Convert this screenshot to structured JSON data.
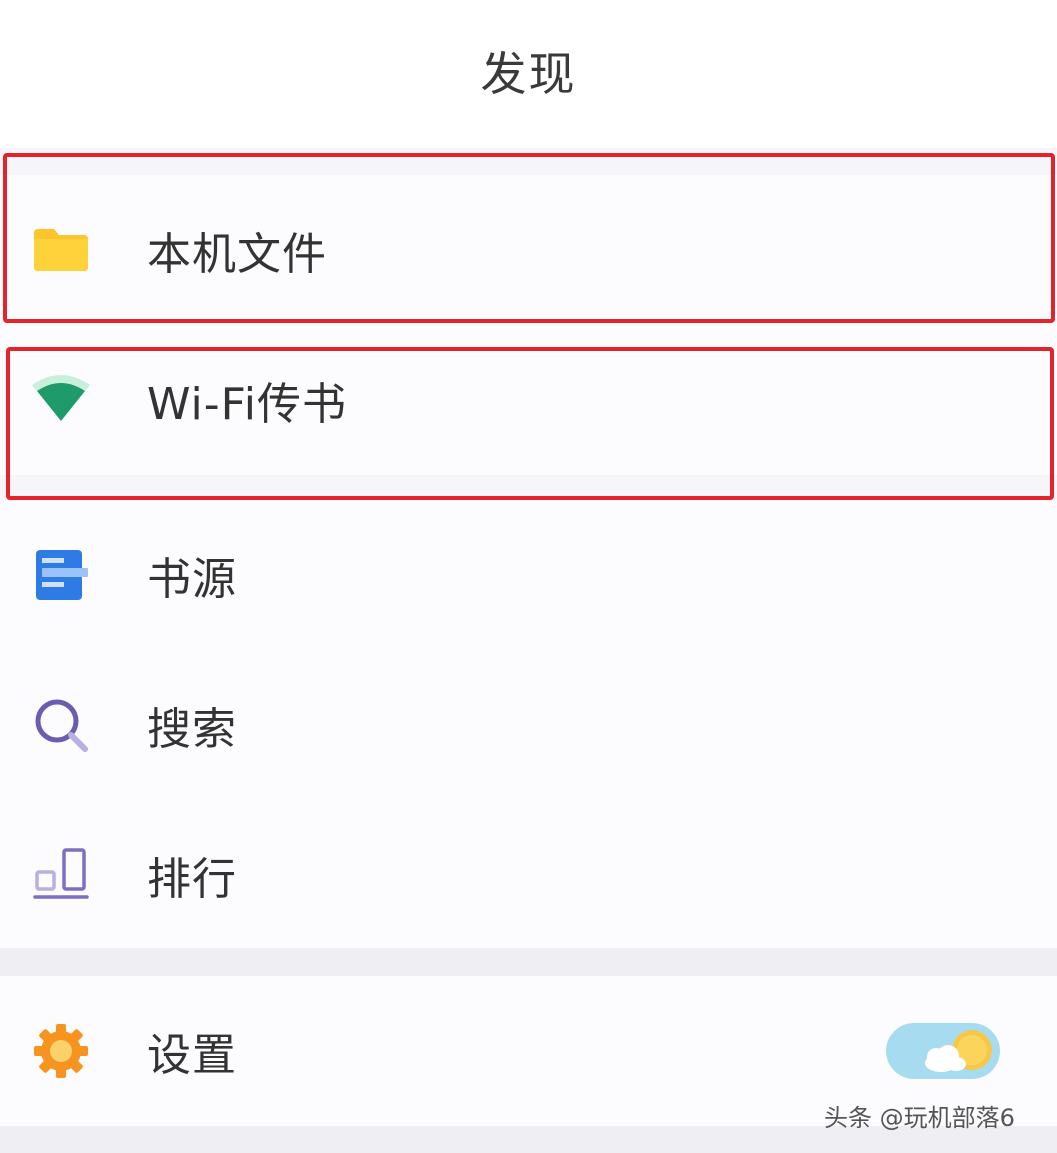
{
  "header": {
    "title": "发现"
  },
  "menu": {
    "items": [
      {
        "id": "local-files",
        "label": "本机文件",
        "icon": "folder-icon",
        "highlighted": true
      },
      {
        "id": "wifi-transfer",
        "label": "Wi-Fi传书",
        "icon": "wifi-icon",
        "highlighted": true
      },
      {
        "id": "book-source",
        "label": "书源",
        "icon": "book-source-icon",
        "highlighted": false
      },
      {
        "id": "search",
        "label": "搜索",
        "icon": "search-icon",
        "highlighted": false
      },
      {
        "id": "ranking",
        "label": "排行",
        "icon": "ranking-icon",
        "highlighted": false
      }
    ]
  },
  "settings": {
    "label": "设置",
    "icon": "gear-icon",
    "theme_toggle": {
      "icon": "sun-cloud-icon",
      "state": "day"
    }
  },
  "watermark": "头条 @玩机部落6",
  "colors": {
    "highlight_border": "#e5232c",
    "folder": "#fbc52b",
    "wifi": "#1f9a6b",
    "book_source": "#2f7be6",
    "search": "#6a5cb0",
    "ranking": "#7d6fc1",
    "gear": "#f6941f",
    "toggle_bg": "#a7dcf0",
    "sun": "#f6c84a"
  }
}
